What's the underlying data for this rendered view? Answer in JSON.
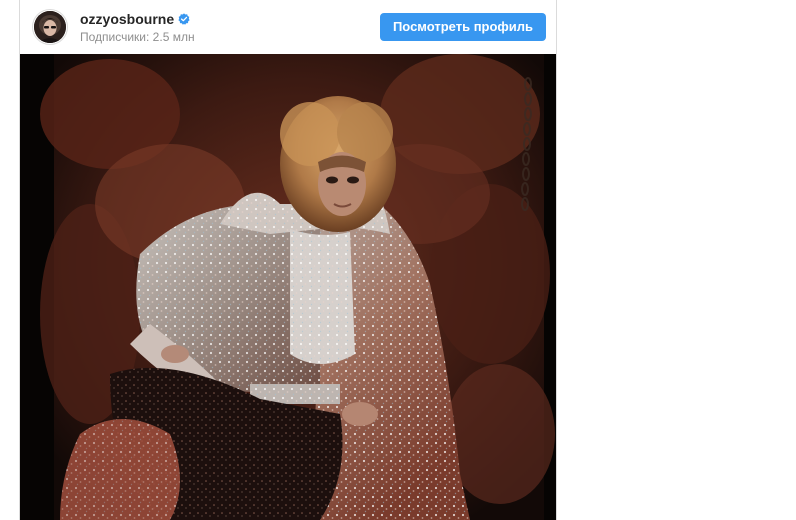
{
  "post": {
    "username": "ozzyosbourne",
    "verified": true,
    "followers_text": "Подписчики: 2.5 млн",
    "view_profile_label": "Посмотреть профиль"
  },
  "icons": {
    "verified": "verified-badge-icon",
    "avatar": "profile-photo"
  },
  "colors": {
    "accent": "#3897f0",
    "username": "#262626",
    "secondary_text": "#8e8e8e",
    "border": "#dbdbdb"
  }
}
